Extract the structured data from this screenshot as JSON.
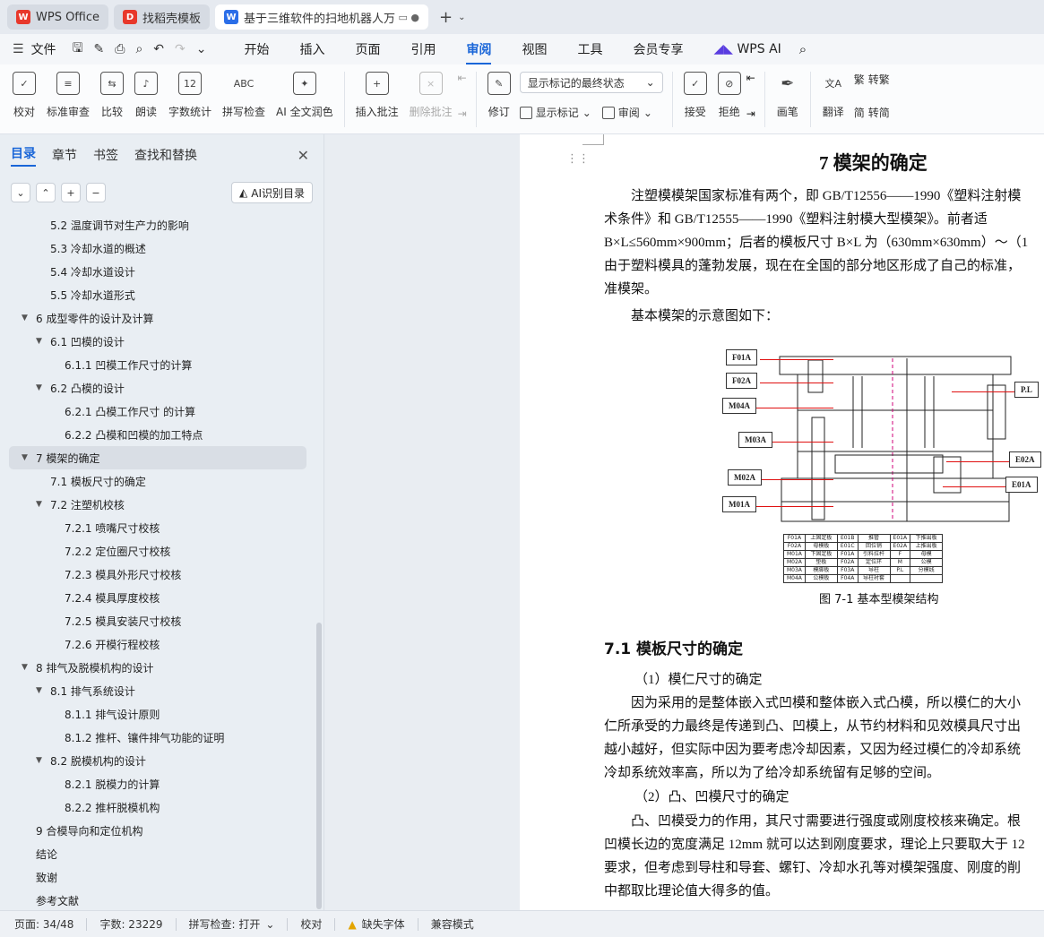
{
  "tabs": [
    {
      "label": "WPS Office",
      "icon": "wps-logo-icon"
    },
    {
      "label": "找稻壳模板",
      "icon": "daoke-icon"
    },
    {
      "label": "基于三维软件的扫地机器人万",
      "icon": "word-doc-icon"
    }
  ],
  "menubar": {
    "file": "文件",
    "items": [
      "开始",
      "插入",
      "页面",
      "引用",
      "审阅",
      "视图",
      "工具",
      "会员专享"
    ],
    "active": "审阅",
    "wps_ai": "WPS AI"
  },
  "ribbon": {
    "left": [
      {
        "label": "校对",
        "icon": "proofread-icon"
      },
      {
        "label": "标准审查",
        "icon": "standard-review-icon"
      },
      {
        "label": "比较",
        "icon": "compare-icon"
      },
      {
        "label": "朗读",
        "icon": "read-aloud-icon"
      },
      {
        "label": "字数统计",
        "icon": "word-count-icon"
      },
      {
        "label": "拼写检查",
        "icon": "spellcheck-icon"
      },
      {
        "label": "AI 全文润色",
        "icon": "ai-polish-icon"
      }
    ],
    "insert_comment": "插入批注",
    "delete_comment": "删除批注",
    "revise": "修订",
    "markup_state": "显示标记的最终状态",
    "show_markup": "显示标记",
    "review": "审阅",
    "accept": "接受",
    "reject": "拒绝",
    "pen": "画笔",
    "translate": "翻译",
    "to_traditional": "转繁",
    "to_simplified": "转简"
  },
  "nav": {
    "tabs": [
      "目录",
      "章节",
      "书签",
      "查找和替换"
    ],
    "active_tab": "目录",
    "ai_toc": "AI识别目录",
    "items": [
      {
        "text": "5.2  温度调节对生产力的影响",
        "level": 2,
        "arrow": ""
      },
      {
        "text": "5.3  冷却水道的概述",
        "level": 2,
        "arrow": ""
      },
      {
        "text": "5.4  冷却水道设计",
        "level": 2,
        "arrow": ""
      },
      {
        "text": "5.5  冷却水道形式",
        "level": 2,
        "arrow": ""
      },
      {
        "text": "6  成型零件的设计及计算",
        "level": 1,
        "arrow": "▼"
      },
      {
        "text": "6.1  凹模的设计",
        "level": 2,
        "arrow": "▼"
      },
      {
        "text": "6.1.1  凹模工作尺寸的计算",
        "level": 3,
        "arrow": ""
      },
      {
        "text": "6.2  凸模的设计",
        "level": 2,
        "arrow": "▼"
      },
      {
        "text": "6.2.1  凸模工作尺寸  的计算",
        "level": 3,
        "arrow": ""
      },
      {
        "text": "6.2.2  凸模和凹模的加工特点",
        "level": 3,
        "arrow": ""
      },
      {
        "text": "7  模架的确定",
        "level": 1,
        "arrow": "▼",
        "selected": true
      },
      {
        "text": "7.1  模板尺寸的确定",
        "level": 2,
        "arrow": ""
      },
      {
        "text": "7.2  注塑机校核",
        "level": 2,
        "arrow": "▼"
      },
      {
        "text": "7.2.1  喷嘴尺寸校核",
        "level": 3,
        "arrow": ""
      },
      {
        "text": "7.2.2  定位圈尺寸校核",
        "level": 3,
        "arrow": ""
      },
      {
        "text": "7.2.3  模具外形尺寸校核",
        "level": 3,
        "arrow": ""
      },
      {
        "text": "7.2.4  模具厚度校核",
        "level": 3,
        "arrow": ""
      },
      {
        "text": "7.2.5  模具安装尺寸校核",
        "level": 3,
        "arrow": ""
      },
      {
        "text": "7.2.6  开模行程校核",
        "level": 3,
        "arrow": ""
      },
      {
        "text": "8  排气及脱模机构的设计",
        "level": 1,
        "arrow": "▼"
      },
      {
        "text": "8.1  排气系统设计",
        "level": 2,
        "arrow": "▼"
      },
      {
        "text": "8.1.1  排气设计原则",
        "level": 3,
        "arrow": ""
      },
      {
        "text": "8.1.2  推杆、镶件排气功能的证明",
        "level": 3,
        "arrow": ""
      },
      {
        "text": "8.2  脱模机构的设计",
        "level": 2,
        "arrow": "▼"
      },
      {
        "text": "8.2.1  脱模力的计算",
        "level": 3,
        "arrow": ""
      },
      {
        "text": "8.2.2  推杆脱模机构",
        "level": 3,
        "arrow": ""
      },
      {
        "text": "9  合模导向和定位机构",
        "level": 1,
        "arrow": ""
      },
      {
        "text": "结论",
        "level": 1,
        "arrow": ""
      },
      {
        "text": "致谢",
        "level": 1,
        "arrow": ""
      },
      {
        "text": "参考文献",
        "level": 1,
        "arrow": ""
      }
    ]
  },
  "doc": {
    "title": "7  模架的确定",
    "p1": [
      "注塑模模架国家标准有两个，即 GB/T12556——1990《塑料注射模",
      "术条件》和 GB/T12555——1990《塑料注射模大型模架》。前者适",
      "B×L≤560mm×900mm；后者的模板尺寸 B×L 为（630mm×630mm）～（1",
      "由于塑料模具的蓬勃发展，现在在全国的部分地区形成了自己的标准，",
      "准模架。"
    ],
    "p2": "基本模架的示意图如下：",
    "figure": {
      "left_labels": [
        "F01A",
        "F02A",
        "M04A",
        "M03A",
        "M02A",
        "M01A"
      ],
      "right_labels": [
        "P.L",
        "E02A",
        "E01A"
      ],
      "table": [
        [
          "F01A",
          "上固定板",
          "E01B",
          "推管",
          "E01A",
          "下推出板"
        ],
        [
          "F02A",
          "母模板",
          "E01C",
          "回位销",
          "E02A",
          "上推出板"
        ],
        [
          "M01A",
          "下固定板",
          "F01A",
          "引料拉杆",
          "F",
          "母模"
        ],
        [
          "M02A",
          "垫板",
          "F02A",
          "定位环",
          "M",
          "公模"
        ],
        [
          "M03A",
          "模脚板",
          "F03A",
          "导柱",
          "P.L",
          "分模线"
        ],
        [
          "M04A",
          "公模板",
          "F04A",
          "导柱衬套",
          "",
          ""
        ]
      ]
    },
    "caption": "图 7-1  基本型模架结构",
    "h2": "7.1  模板尺寸的确定",
    "s1": "（1）模仁尺寸的确定",
    "p3": [
      "因为采用的是整体嵌入式凹模和整体嵌入式凸模，所以模仁的大小",
      "仁所承受的力最终是传递到凸、凹模上，从节约材料和见效模具尺寸出",
      "越小越好，但实际中因为要考虑冷却因素，又因为经过模仁的冷却系统",
      "冷却系统效率高，所以为了给冷却系统留有足够的空间。"
    ],
    "s2": "（2）凸、凹模尺寸的确定",
    "p4": [
      "凸、凹模受力的作用，其尺寸需要进行强度或刚度校核来确定。根",
      "凹模长边的宽度满足 12mm 就可以达到刚度要求，理论上只要取大于 12",
      "要求，但考虑到导柱和导套、螺钉、冷却水孔等对模架强度、刚度的削",
      "中都取比理论值大得多的值。"
    ]
  },
  "status": {
    "page": "页面: 34/48",
    "words": "字数: 23229",
    "spell": "拼写检查: 打开",
    "proof": "校对",
    "missing_font": "缺失字体",
    "compat": "兼容模式"
  }
}
